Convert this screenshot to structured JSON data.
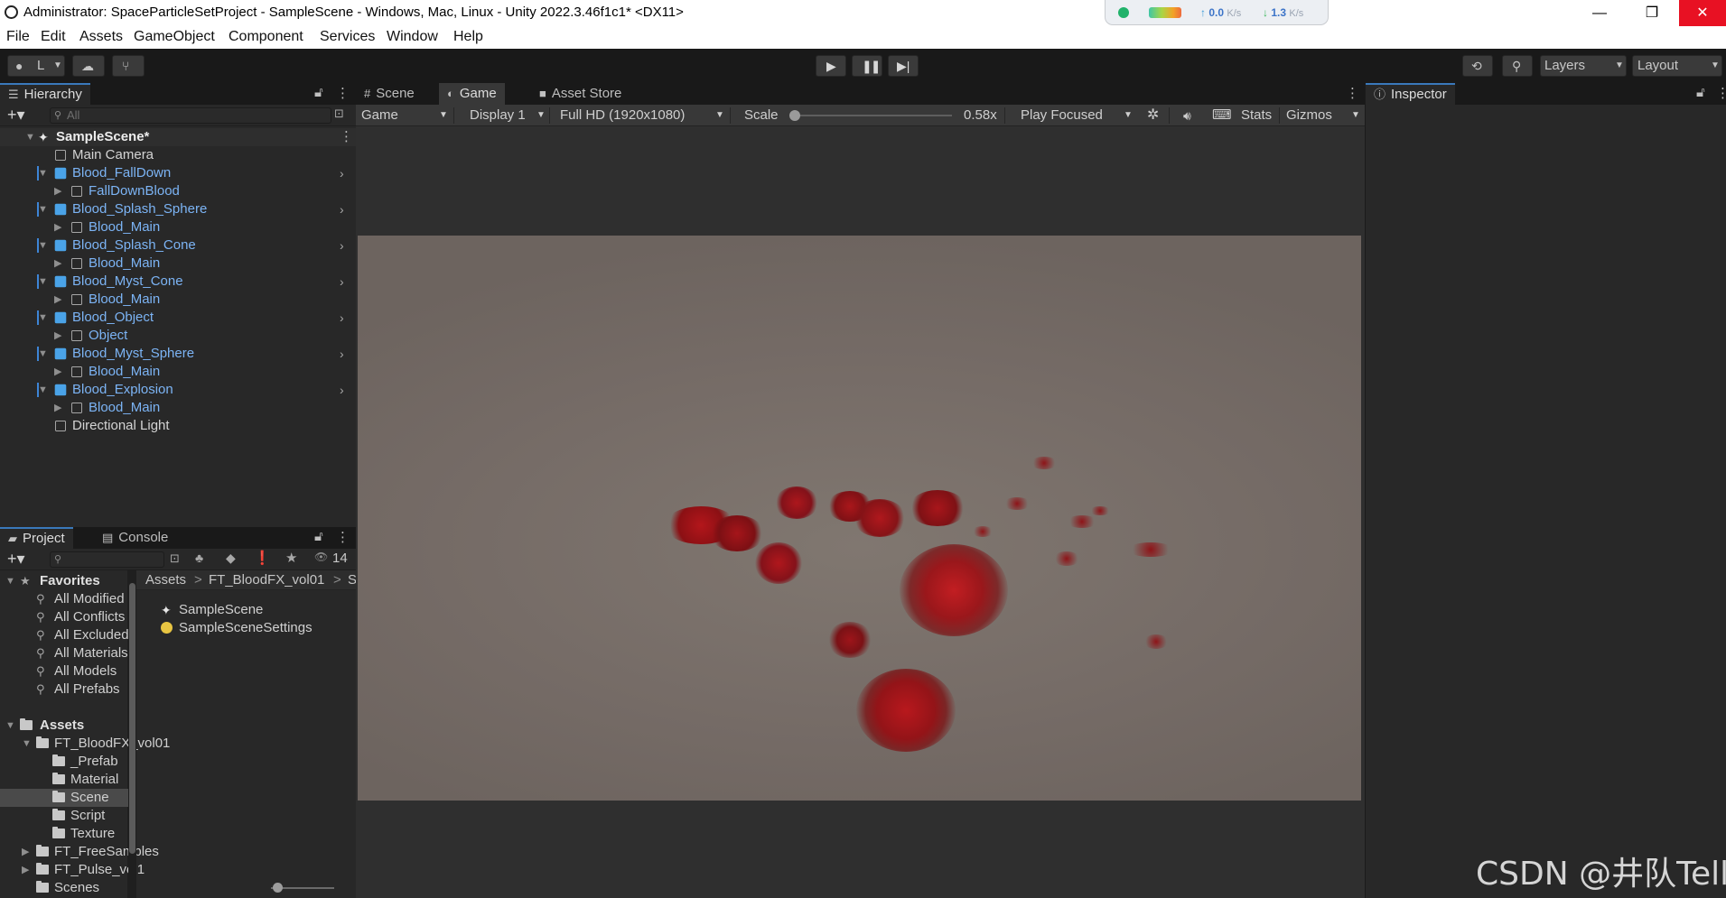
{
  "window": {
    "title": "Administrator: SpaceParticleSetProject - SampleScene - Windows, Mac, Linux - Unity 2022.3.46f1c1* <DX11>",
    "controls": {
      "minimize": "—",
      "maximize": "❐",
      "close": "✕"
    }
  },
  "network_widget": {
    "upload_value": "0.0",
    "download_value": "1.3",
    "unit": "K/s",
    "upload_arrow": "↑",
    "download_arrow": "↓"
  },
  "menu": [
    "File",
    "Edit",
    "Assets",
    "GameObject",
    "Component",
    "Services",
    "Window",
    "Help"
  ],
  "toolbar": {
    "account_label": "L",
    "layers_label": "Layers",
    "layout_label": "Layout"
  },
  "hierarchy": {
    "tab_label": "Hierarchy",
    "search_placeholder": "All",
    "rows": [
      {
        "label": "SampleScene*",
        "kind": "scene"
      },
      {
        "label": "Main Camera",
        "kind": "plain"
      },
      {
        "label": "Blood_FallDown",
        "kind": "prefab"
      },
      {
        "label": "FallDownBlood",
        "kind": "prefab"
      },
      {
        "label": "Blood_Splash_Sphere",
        "kind": "prefab"
      },
      {
        "label": "Blood_Main",
        "kind": "prefab"
      },
      {
        "label": "Blood_Splash_Cone",
        "kind": "prefab"
      },
      {
        "label": "Blood_Main",
        "kind": "prefab"
      },
      {
        "label": "Blood_Myst_Cone",
        "kind": "prefab"
      },
      {
        "label": "Blood_Main",
        "kind": "prefab"
      },
      {
        "label": "Blood_Object",
        "kind": "prefab"
      },
      {
        "label": "Object",
        "kind": "prefab"
      },
      {
        "label": "Blood_Myst_Sphere",
        "kind": "prefab"
      },
      {
        "label": "Blood_Main",
        "kind": "prefab"
      },
      {
        "label": "Blood_Explosion",
        "kind": "prefab"
      },
      {
        "label": "Blood_Main",
        "kind": "prefab"
      },
      {
        "label": "Directional Light",
        "kind": "plain"
      }
    ]
  },
  "game_panel": {
    "tabs": [
      "Scene",
      "Game",
      "Asset Store"
    ],
    "active_tab": "Game",
    "toolbar": {
      "view_mode": "Game",
      "display": "Display 1",
      "resolution": "Full HD (1920x1080)",
      "scale_label": "Scale",
      "scale_value": "0.58x",
      "play_mode": "Play Focused",
      "stats_label": "Stats",
      "gizmos_label": "Gizmos"
    }
  },
  "inspector": {
    "tab_label": "Inspector"
  },
  "project": {
    "tabs": [
      "Project",
      "Console"
    ],
    "hidden_count": "14",
    "favorites_label": "Favorites",
    "favorites": [
      "All Modified",
      "All Conflicts",
      "All Excluded",
      "All Materials",
      "All Models",
      "All Prefabs"
    ],
    "assets_label": "Assets",
    "tree": [
      {
        "label": "FT_BloodFX_vol01",
        "expanded": true
      },
      {
        "label": "_Prefab"
      },
      {
        "label": "Material"
      },
      {
        "label": "Scene",
        "selected": true
      },
      {
        "label": "Script"
      },
      {
        "label": "Texture"
      },
      {
        "label": "FT_FreeSamples"
      },
      {
        "label": "FT_Pulse_vol1"
      },
      {
        "label": "Scenes"
      }
    ],
    "breadcrumb": [
      "Assets",
      "FT_BloodFX_vol01",
      "S"
    ],
    "files": [
      "SampleScene",
      "SampleSceneSettings"
    ]
  },
  "watermark": "CSDN @井队Tell",
  "colors": {
    "accent": "#3a79bb",
    "prefab_text": "#7cb4f5",
    "blood": "#b0141a",
    "close_button": "#e81123"
  }
}
